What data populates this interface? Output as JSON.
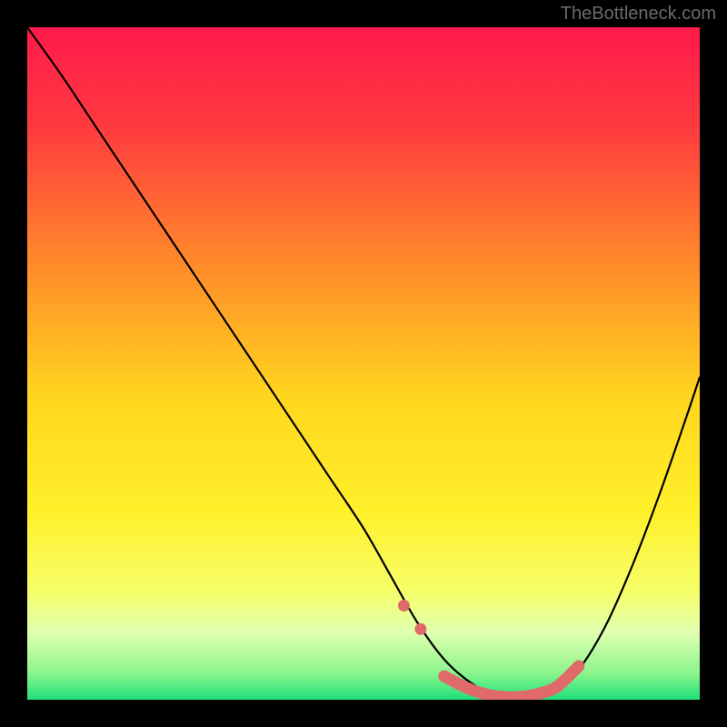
{
  "watermark": "TheBottleneck.com",
  "chart_data": {
    "type": "line",
    "title": "",
    "xlabel": "",
    "ylabel": "",
    "xlim": [
      0,
      100
    ],
    "ylim": [
      0,
      100
    ],
    "grid": false,
    "series": [
      {
        "name": "curve",
        "x": [
          0,
          5,
          10,
          15,
          20,
          25,
          30,
          35,
          40,
          45,
          50,
          54,
          58,
          62,
          66,
          70,
          74,
          78,
          82,
          86,
          90,
          94,
          98,
          100
        ],
        "y": [
          100,
          93,
          85.5,
          78,
          70.5,
          63,
          55.5,
          48,
          40.5,
          33,
          25.5,
          18.5,
          11.5,
          6,
          2.5,
          0.5,
          0,
          1,
          4.5,
          11,
          20,
          30.5,
          42,
          48
        ]
      },
      {
        "name": "highlight-dots",
        "x": [
          56,
          58.5
        ],
        "y": [
          14,
          10.5
        ]
      },
      {
        "name": "highlight-segment",
        "x": [
          62,
          66,
          70,
          74,
          78,
          80,
          81,
          82
        ],
        "y": [
          3.5,
          1.5,
          0.5,
          0.5,
          1.5,
          3,
          4,
          5
        ]
      }
    ],
    "background_gradient": {
      "type": "vertical",
      "stops": [
        {
          "pos": 0.0,
          "color": "#ff1a4b"
        },
        {
          "pos": 0.15,
          "color": "#ff3b3f"
        },
        {
          "pos": 0.35,
          "color": "#ff8a2a"
        },
        {
          "pos": 0.55,
          "color": "#ffd61f"
        },
        {
          "pos": 0.72,
          "color": "#fff02a"
        },
        {
          "pos": 0.84,
          "color": "#f6ff6a"
        },
        {
          "pos": 0.9,
          "color": "#e0ffb0"
        },
        {
          "pos": 0.96,
          "color": "#8cf58c"
        },
        {
          "pos": 1.0,
          "color": "#1ee07a"
        }
      ]
    },
    "highlight_color": "#e06a6a",
    "curve_color": "#000000"
  }
}
